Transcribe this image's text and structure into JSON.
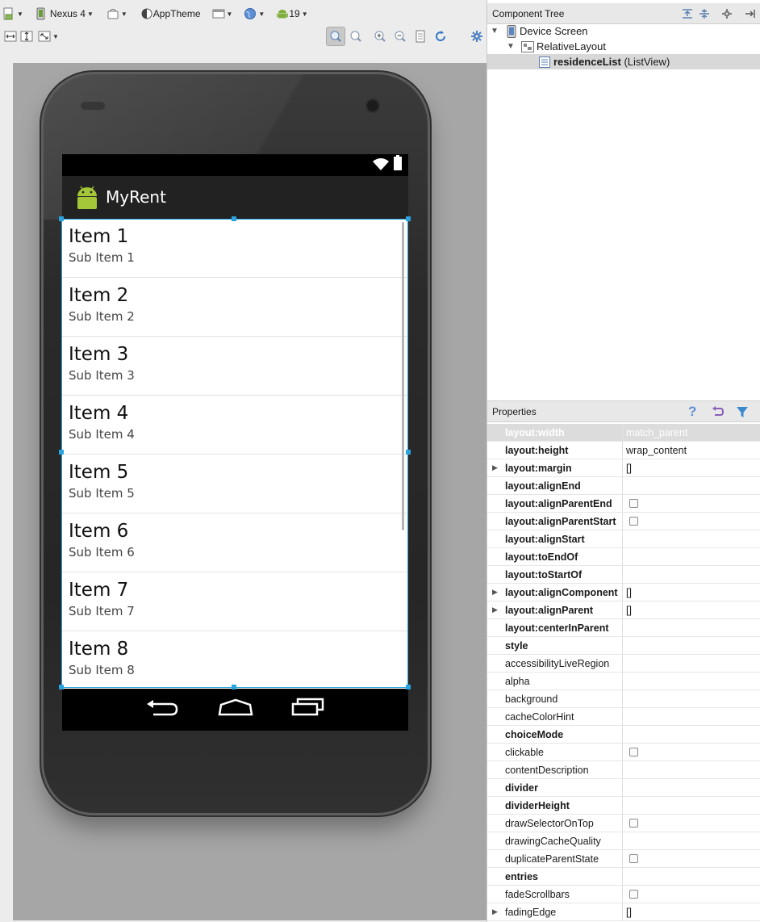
{
  "toolbar": {
    "device": "Nexus 4",
    "theme": "AppTheme",
    "api_level": "19"
  },
  "component_tree": {
    "title": "Component Tree",
    "nodes": [
      {
        "label": "Device Screen"
      },
      {
        "label": "RelativeLayout"
      },
      {
        "label_bold": "residenceList",
        "label_rest": " (ListView)"
      }
    ]
  },
  "device": {
    "app_title": "MyRent",
    "list_items": [
      {
        "title": "Item 1",
        "sub": "Sub Item 1"
      },
      {
        "title": "Item 2",
        "sub": "Sub Item 2"
      },
      {
        "title": "Item 3",
        "sub": "Sub Item 3"
      },
      {
        "title": "Item 4",
        "sub": "Sub Item 4"
      },
      {
        "title": "Item 5",
        "sub": "Sub Item 5"
      },
      {
        "title": "Item 6",
        "sub": "Sub Item 6"
      },
      {
        "title": "Item 7",
        "sub": "Sub Item 7"
      },
      {
        "title": "Item 8",
        "sub": "Sub Item 8"
      }
    ]
  },
  "properties": {
    "title": "Properties",
    "rows": [
      {
        "name": "layout:width",
        "value": "match_parent",
        "bold": true,
        "highlight": true
      },
      {
        "name": "layout:height",
        "value": "wrap_content",
        "bold": true
      },
      {
        "name": "layout:margin",
        "value": "[]",
        "bold": true,
        "expand": true
      },
      {
        "name": "layout:alignEnd",
        "value": "",
        "bold": true
      },
      {
        "name": "layout:alignParentEnd",
        "value": "",
        "bold": true,
        "checkbox": true
      },
      {
        "name": "layout:alignParentStart",
        "value": "",
        "bold": true,
        "checkbox": true
      },
      {
        "name": "layout:alignStart",
        "value": "",
        "bold": true
      },
      {
        "name": "layout:toEndOf",
        "value": "",
        "bold": true
      },
      {
        "name": "layout:toStartOf",
        "value": "",
        "bold": true
      },
      {
        "name": "layout:alignComponent",
        "value": "[]",
        "bold": true,
        "expand": true
      },
      {
        "name": "layout:alignParent",
        "value": "[]",
        "bold": true,
        "expand": true
      },
      {
        "name": "layout:centerInParent",
        "value": "",
        "bold": true
      },
      {
        "name": "style",
        "value": "",
        "bold": true
      },
      {
        "name": "accessibilityLiveRegion",
        "value": ""
      },
      {
        "name": "alpha",
        "value": ""
      },
      {
        "name": "background",
        "value": ""
      },
      {
        "name": "cacheColorHint",
        "value": ""
      },
      {
        "name": "choiceMode",
        "value": "",
        "bold": true
      },
      {
        "name": "clickable",
        "value": "",
        "checkbox": true
      },
      {
        "name": "contentDescription",
        "value": ""
      },
      {
        "name": "divider",
        "value": "",
        "bold": true
      },
      {
        "name": "dividerHeight",
        "value": "",
        "bold": true
      },
      {
        "name": "drawSelectorOnTop",
        "value": "",
        "checkbox": true
      },
      {
        "name": "drawingCacheQuality",
        "value": ""
      },
      {
        "name": "duplicateParentState",
        "value": "",
        "checkbox": true
      },
      {
        "name": "entries",
        "value": "",
        "bold": true
      },
      {
        "name": "fadeScrollbars",
        "value": "",
        "checkbox": true
      },
      {
        "name": "fadingEdge",
        "value": "[]",
        "expand": true
      }
    ]
  },
  "colors": {
    "selection": "#2aa3e0",
    "android_green": "#a4c639"
  }
}
